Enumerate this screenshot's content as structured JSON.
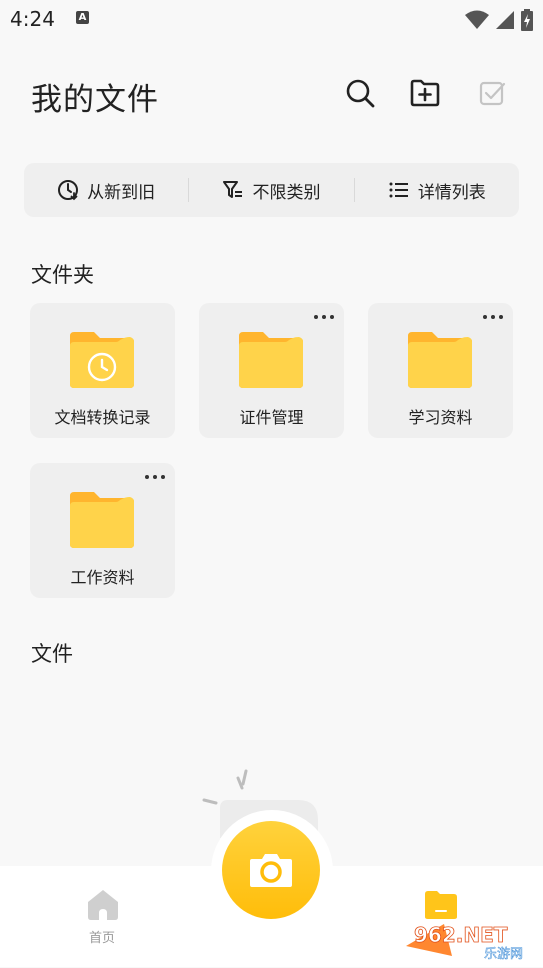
{
  "status_bar": {
    "time": "4:24",
    "indicator": "A"
  },
  "header": {
    "title": "我的文件",
    "icons": [
      "search-icon",
      "new-folder-icon",
      "select-icon"
    ]
  },
  "filter_bar": {
    "sort_label": "从新到旧",
    "type_label": "不限类别",
    "view_label": "详情列表"
  },
  "folders_section": {
    "title": "文件夹",
    "items": [
      {
        "label": "文档转换记录",
        "has_more": false,
        "icon": "folder-clock-icon"
      },
      {
        "label": "证件管理",
        "has_more": true,
        "icon": "folder-icon"
      },
      {
        "label": "学习资料",
        "has_more": true,
        "icon": "folder-icon"
      },
      {
        "label": "工作资料",
        "has_more": true,
        "icon": "folder-icon"
      }
    ]
  },
  "files_section": {
    "title": "文件"
  },
  "bottom_nav": {
    "home_label": "首页",
    "files_label": "",
    "camera_icon": "camera-icon"
  },
  "watermark": {
    "text": "962.NET",
    "subtext": "乐游网"
  },
  "colors": {
    "accent": "#ffc51a",
    "folder_back": "#ffb52e",
    "folder_front": "#ffd34a",
    "background": "#f8f8f8",
    "card": "#efefef"
  }
}
